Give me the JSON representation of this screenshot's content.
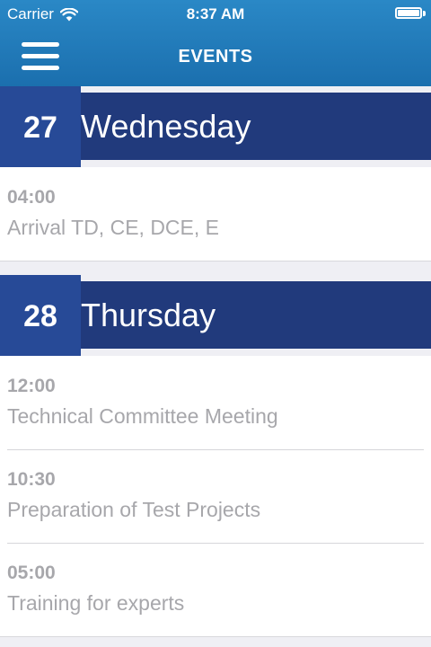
{
  "status_bar": {
    "carrier": "Carrier",
    "time": "8:37 AM",
    "wifi_icon": "wifi-icon",
    "battery_icon": "battery-icon",
    "battery_level": 1.0
  },
  "nav": {
    "menu_icon": "hamburger-menu-icon",
    "title": "EVENTS"
  },
  "colors": {
    "nav_bar": "#1f78b8",
    "day_band": "#213a7c",
    "day_number_box": "#274a97",
    "event_text": "#a7a7ab",
    "background": "#efeff4"
  },
  "days": [
    {
      "number": "27",
      "name": "Wednesday",
      "events": [
        {
          "time": "04:00",
          "title": "Arrival TD, CE, DCE, E"
        }
      ]
    },
    {
      "number": "28",
      "name": "Thursday",
      "events": [
        {
          "time": "12:00",
          "title": "Technical Committee Meeting"
        },
        {
          "time": "10:30",
          "title": "Preparation of Test Projects"
        },
        {
          "time": "05:00",
          "title": "Training for experts"
        }
      ]
    }
  ]
}
